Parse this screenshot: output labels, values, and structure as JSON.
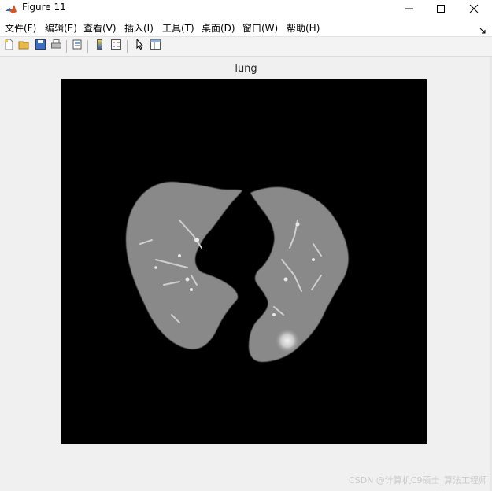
{
  "window": {
    "title": "Figure 11"
  },
  "menu": {
    "items": [
      {
        "label": "文件(F)"
      },
      {
        "label": "编辑(E)"
      },
      {
        "label": "查看(V)"
      },
      {
        "label": "插入(I)"
      },
      {
        "label": "工具(T)"
      },
      {
        "label": "桌面(D)"
      },
      {
        "label": "窗口(W)"
      },
      {
        "label": "帮助(H)"
      }
    ]
  },
  "toolbar": {
    "buttons": [
      {
        "icon": "new-figure-icon"
      },
      {
        "icon": "open-file-icon"
      },
      {
        "icon": "save-icon"
      },
      {
        "icon": "print-icon"
      },
      {
        "icon": "print-preview-icon"
      },
      {
        "icon": "colorbar-icon"
      },
      {
        "icon": "legend-icon"
      },
      {
        "icon": "edit-plot-arrow-icon"
      },
      {
        "icon": "property-inspector-icon"
      }
    ]
  },
  "plot": {
    "title": "lung",
    "image_description": "segmented CT lung image on black background"
  },
  "watermark": "CSDN @计算机C9硕士_算法工程师",
  "colors": {
    "window_bg": "#f0f0f0",
    "axes_bg": "#000000",
    "lung_tissue": "#8a8a8a"
  }
}
